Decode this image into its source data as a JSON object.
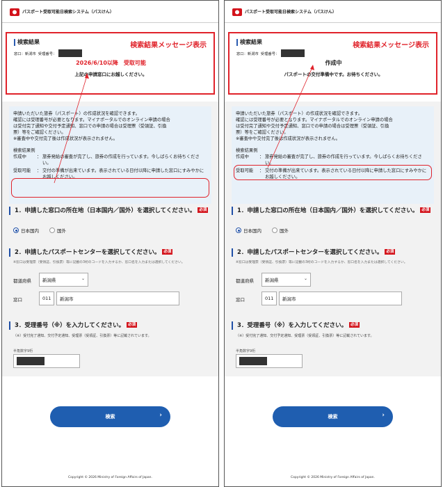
{
  "header": {
    "title": "パスポート受取可能日検索システム（パスけん）"
  },
  "result": {
    "title": "検索結果",
    "tag": "検索結果メッセージ表示",
    "location": "窓口：新潟市",
    "receipt_label": "受理番号："
  },
  "left": {
    "status": "2026/6/10以降　受取可能",
    "message": "上記の申請窓口にお越しください。"
  },
  "right": {
    "status": "作成中",
    "message": "パスポートの交付準備中です。お待ちください。"
  },
  "info": {
    "lines": [
      "申請いただいた旅券（パスポート）の作成状況を確認できます。",
      "確認には受理番号が必要となります。マイナポータルでのオンライン申請の場合",
      "は受付完了通知や交付予定通知、窓口での申請の場合は受理票（受領証、引換",
      "票）等をご確認ください。",
      "※審査中や交付完了後は作成状況が表示されません。"
    ],
    "example_title": "検索結果例",
    "examples": [
      {
        "key": "作成中",
        "colon": "：",
        "value": "旅券発給の審査が完了し、旅券の作成を行っています。今しばらくお待ちください。"
      },
      {
        "key": "受取可能",
        "colon": "：",
        "value": "交付の準備が出来ています。表示されている日付以降に申請した窓口にすみやかにお越しください。"
      }
    ]
  },
  "q1": {
    "label": "1．申請した窓口の所在地（日本国内／国外）を選択してください。",
    "required": "必須",
    "opt1": "日本国内",
    "opt2": "国外"
  },
  "q2": {
    "label": "2．申請したパスポートセンターを選択してください。",
    "required": "必須",
    "note": "※窓口は受理票（受領証、引換票）等に記載の3桁のコードを入力するか、窓口名を入力または選択してください。",
    "pref_label": "都道府県",
    "pref_value": "新潟県",
    "window_label": "窓口",
    "window_code": "011",
    "window_name": "新潟市"
  },
  "q3": {
    "label": "3．受理番号（※）を入力してください。",
    "required": "必須",
    "note": "（※）受付完了通知、交付予定通知、受理票（受領証、引換票）等に記載されています。",
    "hint": "半角数字9桁"
  },
  "search_button": "検索",
  "footer": "Copyright © 2026 Ministry of Foreign Affairs of Japan.",
  "colors": {
    "accent_red": "#e0222a",
    "primary_blue": "#1f5eb0"
  }
}
